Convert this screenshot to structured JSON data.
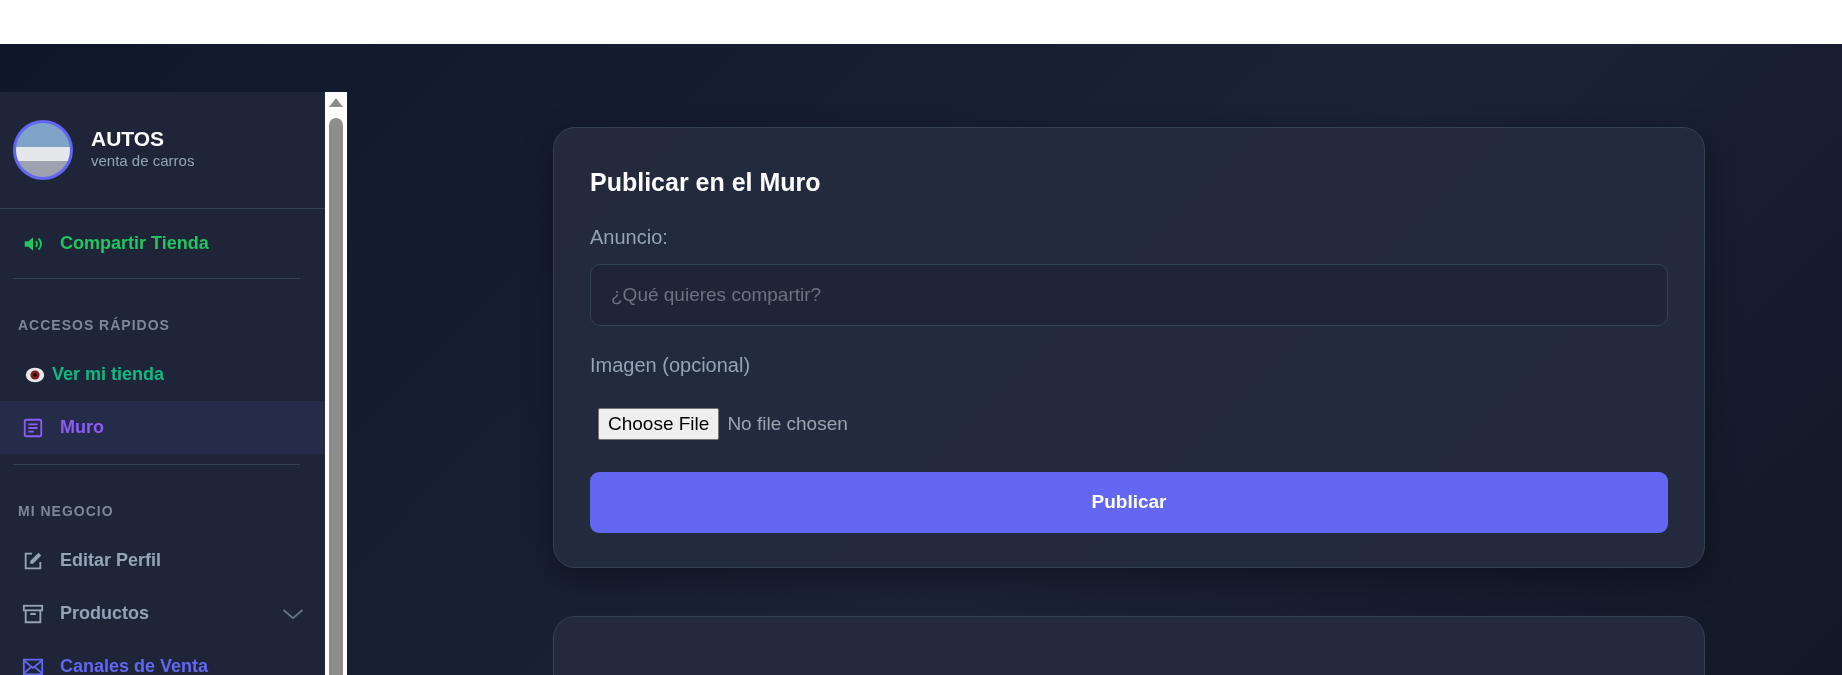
{
  "sidebar": {
    "brand": {
      "title": "AUTOS",
      "subtitle": "venta de carros"
    },
    "share": {
      "label": "Compartir Tienda",
      "color": "#22c55e"
    },
    "sections": [
      {
        "title": "ACCESOS RÁPIDOS",
        "items": [
          {
            "kind": "eye",
            "label": "Ver mi tienda",
            "color": "#10b981",
            "selected": false
          },
          {
            "kind": "document",
            "label": "Muro",
            "color": "#8b5cf6",
            "selected": true
          }
        ]
      },
      {
        "title": "MI NEGOCIO",
        "items": [
          {
            "kind": "edit",
            "label": "Editar Perfil",
            "color": "#94a3b8",
            "selected": false
          },
          {
            "kind": "archive",
            "label": "Productos",
            "color": "#94a3b8",
            "selected": false,
            "expanded": false
          },
          {
            "kind": "mail",
            "label": "Canales de Venta",
            "color": "#6366f1",
            "selected": false
          }
        ]
      }
    ]
  },
  "post_form": {
    "title": "Publicar en el Muro",
    "ad_label": "Anuncio:",
    "ad_placeholder": "¿Qué quieres compartir?",
    "image_label": "Imagen (opcional)",
    "file_button": "Choose File",
    "file_status": "No file chosen",
    "submit": "Publicar"
  }
}
